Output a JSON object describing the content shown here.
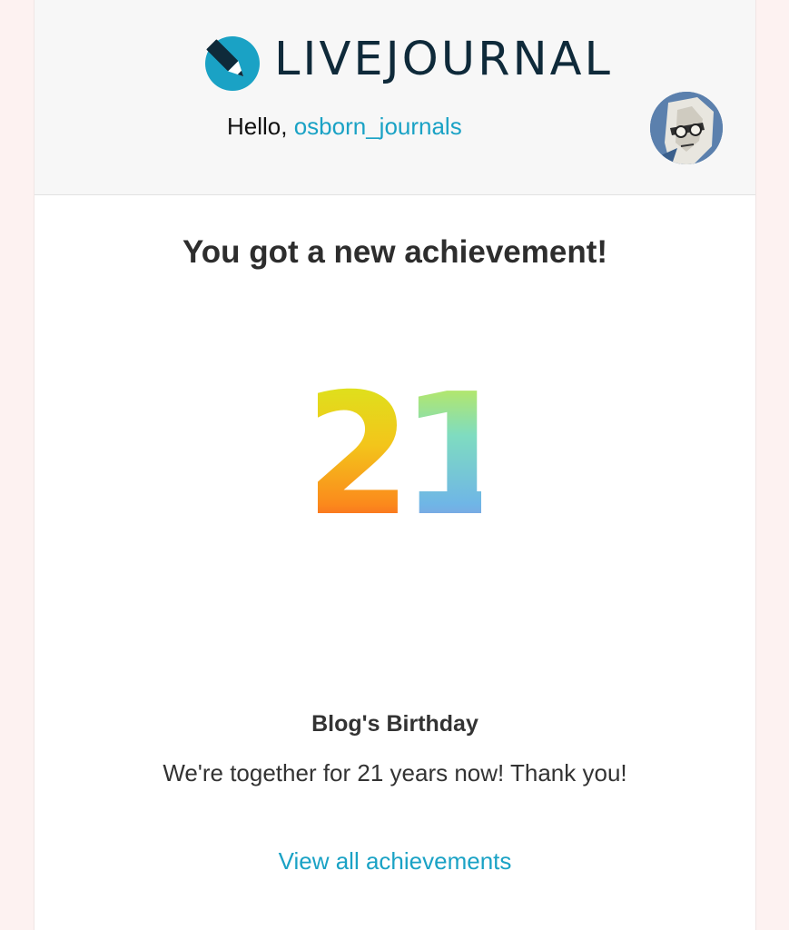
{
  "header": {
    "logo_text": "LIVEJOURNAL",
    "greeting": "Hello, ",
    "username": "osborn_journals"
  },
  "achievement": {
    "heading": "You got a new achievement!",
    "badge_number": "21",
    "name": "Blog's Birthday",
    "description": "We're together for 21 years now! Thank you!",
    "view_all_link": "View all achievements"
  },
  "colors": {
    "brand_blue": "#1aa2c5",
    "logo_text": "#0f2a3a",
    "header_bg": "#f7f7f7",
    "page_bg": "#fdf2f1"
  },
  "icons": {
    "logo": "livejournal-pen-icon",
    "avatar": "user-avatar",
    "badge": "birthday-21-badge"
  }
}
